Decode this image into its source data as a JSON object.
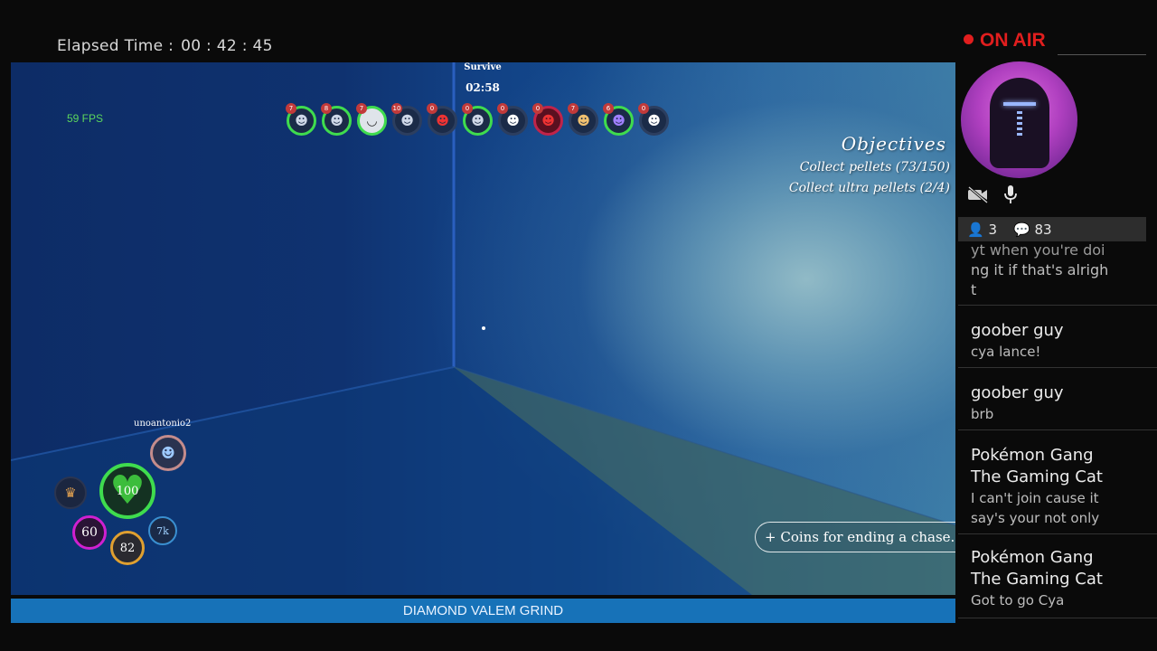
{
  "elapsed": {
    "label": "Elapsed Time :",
    "value": "00 : 42 : 45"
  },
  "game": {
    "fps": "59 FPS",
    "mode": "Survive",
    "timer": "02:58",
    "players": [
      {
        "level": "7",
        "ring": "green"
      },
      {
        "level": "8",
        "ring": "green"
      },
      {
        "level": "7",
        "ring": "green"
      },
      {
        "level": "10",
        "ring": "none"
      },
      {
        "level": "0",
        "ring": "none"
      },
      {
        "level": "0",
        "ring": "green"
      },
      {
        "level": "0",
        "ring": "none"
      },
      {
        "level": "0",
        "ring": "red"
      },
      {
        "level": "7",
        "ring": "none"
      },
      {
        "level": "6",
        "ring": "green"
      },
      {
        "level": "0",
        "ring": "none"
      }
    ],
    "objectives": {
      "title": "Objectives",
      "items": [
        "Collect pellets (73/150)",
        "Collect ultra pellets (2/4)"
      ]
    },
    "username": "unoantonio2",
    "hud": {
      "health": "100",
      "stat_purple": "60",
      "stat_orange": "82",
      "stat_blue": "7k"
    },
    "toast": "+ Coins for ending a chase."
  },
  "banner": "DIAMOND VALEM GRIND",
  "sidebar": {
    "on_air": "ON AIR",
    "viewers": "3",
    "comments": "83",
    "chat": [
      {
        "user": "",
        "lines": [
          "yt when you're doi",
          "ng it if that's alrigh",
          "t"
        ]
      },
      {
        "user": "goober guy",
        "lines": [
          "cya lance!"
        ]
      },
      {
        "user": "goober guy",
        "lines": [
          "brb"
        ]
      },
      {
        "user": "Pokémon Gang The Gaming Cat",
        "lines": [
          "I can't join cause it",
          "say's your not only"
        ]
      },
      {
        "user": "Pokémon Gang The Gaming Cat",
        "lines": [
          "Got to go Cya"
        ]
      }
    ]
  },
  "colors": {
    "on_air": "#e11e1e",
    "banner": "#1772b8",
    "fps": "#5cd65c",
    "health_ring": "#3fdc4e"
  }
}
